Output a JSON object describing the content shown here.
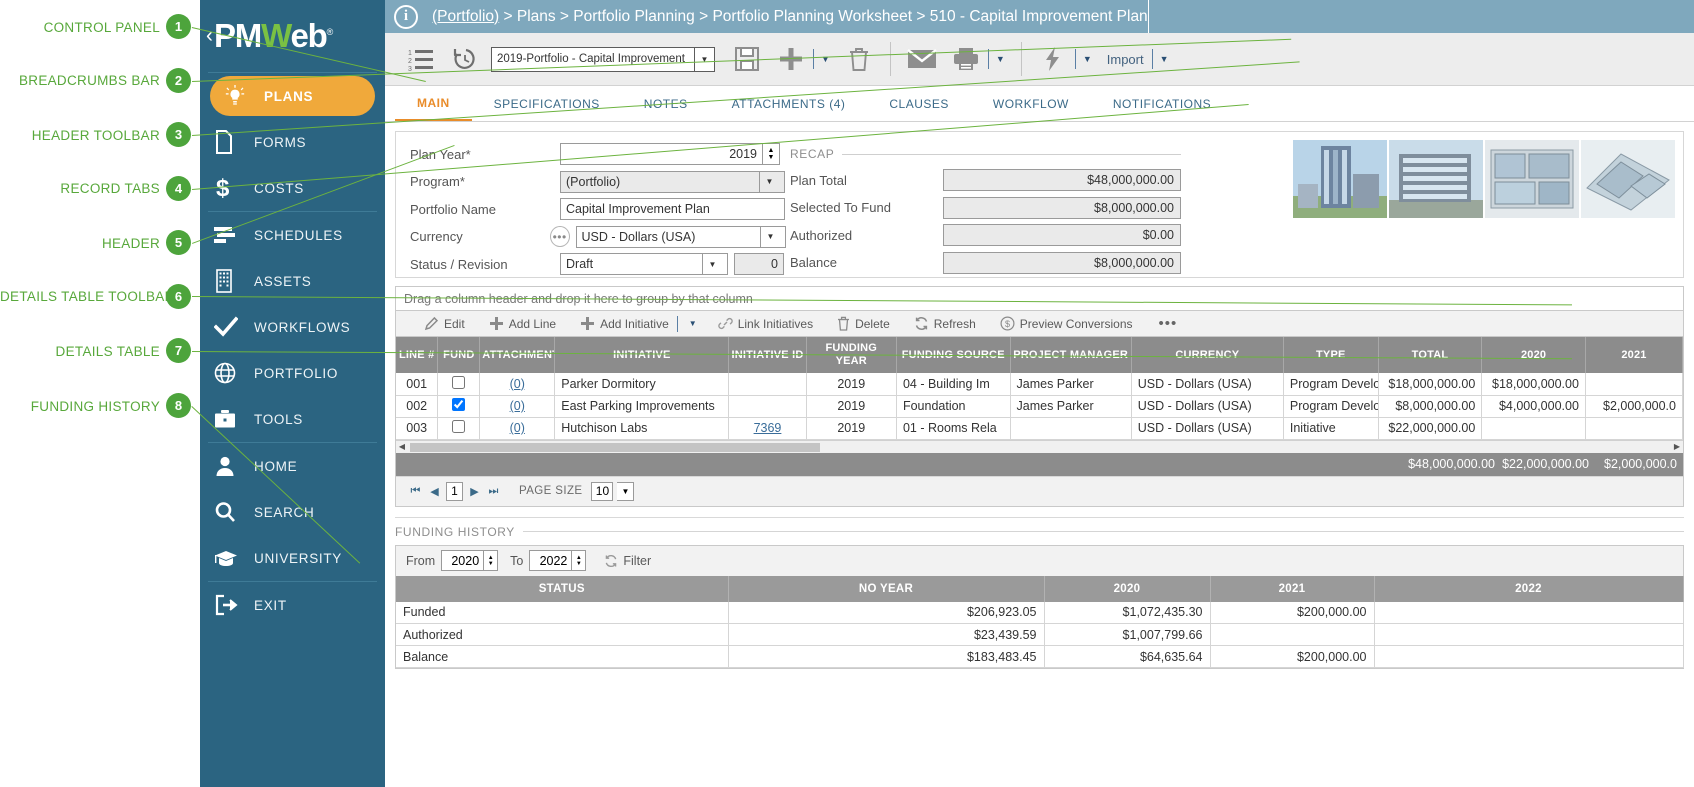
{
  "annotations": [
    {
      "n": "1",
      "label": "CONTROL PANEL"
    },
    {
      "n": "2",
      "label": "BREADCRUMBS BAR"
    },
    {
      "n": "3",
      "label": "HEADER TOOLBAR"
    },
    {
      "n": "4",
      "label": "RECORD TABS"
    },
    {
      "n": "5",
      "label": "HEADER"
    },
    {
      "n": "6",
      "label": "DETAILS TABLE TOOLBAR"
    },
    {
      "n": "7",
      "label": "DETAILS TABLE"
    },
    {
      "n": "8",
      "label": "FUNDING HISTORY"
    }
  ],
  "sidebar": {
    "logo": {
      "chevron": "‹",
      "pm": "PM",
      "w": "W",
      "eb": "eb",
      "reg": "®"
    },
    "items": [
      {
        "label": "PLANS",
        "icon": "lightbulb-icon",
        "active": true
      },
      {
        "label": "FORMS",
        "icon": "document-icon",
        "active": false
      },
      {
        "label": "COSTS",
        "icon": "dollar-icon",
        "active": false
      },
      {
        "label": "SCHEDULES",
        "icon": "schedule-icon",
        "active": false
      },
      {
        "label": "ASSETS",
        "icon": "building-icon",
        "active": false
      },
      {
        "label": "WORKFLOWS",
        "icon": "check-icon",
        "active": false
      },
      {
        "label": "PORTFOLIO",
        "icon": "globe-icon",
        "active": false
      },
      {
        "label": "TOOLS",
        "icon": "briefcase-icon",
        "active": false
      },
      {
        "label": "HOME",
        "icon": "person-icon",
        "active": false
      },
      {
        "label": "SEARCH",
        "icon": "search-icon",
        "active": false
      },
      {
        "label": "UNIVERSITY",
        "icon": "graduation-cap-icon",
        "active": false
      },
      {
        "label": "EXIT",
        "icon": "exit-icon",
        "active": false
      }
    ]
  },
  "breadcrumb": {
    "root": "(Portfolio)",
    "rest": " > Plans > Portfolio Planning > Portfolio Planning Worksheet > 510 - Capital Improvement Plan"
  },
  "toolbar": {
    "record_select_value": "2019-Portfolio - Capital Improvement",
    "import_label": "Import",
    "icons": [
      "list-icon",
      "history-icon",
      "save-icon",
      "add-icon",
      "delete-icon",
      "email-icon",
      "print-icon",
      "lightning-icon"
    ]
  },
  "tabs": [
    {
      "label": "MAIN",
      "active": true
    },
    {
      "label": "SPECIFICATIONS",
      "active": false
    },
    {
      "label": "NOTES",
      "active": false
    },
    {
      "label": "ATTACHMENTS (4)",
      "active": false
    },
    {
      "label": "CLAUSES",
      "active": false
    },
    {
      "label": "WORKFLOW",
      "active": false
    },
    {
      "label": "NOTIFICATIONS",
      "active": false
    }
  ],
  "header_form": {
    "plan_year": {
      "label": "Plan Year*",
      "value": "2019"
    },
    "program": {
      "label": "Program*",
      "value": "(Portfolio)"
    },
    "portfolio_name": {
      "label": "Portfolio Name",
      "value": "Capital Improvement Plan"
    },
    "currency": {
      "label": "Currency",
      "value": "USD - Dollars (USA)"
    },
    "status": {
      "label": "Status / Revision",
      "value": "Draft",
      "revision": "0"
    }
  },
  "recap": {
    "title": "RECAP",
    "rows": [
      {
        "label": "Plan Total",
        "value": "$48,000,000.00"
      },
      {
        "label": "Selected To Fund",
        "value": "$8,000,000.00"
      },
      {
        "label": "Authorized",
        "value": "$0.00"
      },
      {
        "label": "Balance",
        "value": "$8,000,000.00"
      }
    ]
  },
  "details": {
    "group_hint": "Drag a column header and drop it here to group by that column",
    "toolbar": [
      {
        "label": "Edit",
        "icon": "pencil-icon"
      },
      {
        "label": "Add Line",
        "icon": "plus-icon"
      },
      {
        "label": "Add Initiative",
        "icon": "plus-icon"
      },
      {
        "label": "Link Initiatives",
        "icon": "link-icon"
      },
      {
        "label": "Delete",
        "icon": "trash-icon"
      },
      {
        "label": "Refresh",
        "icon": "refresh-icon"
      },
      {
        "label": "Preview Conversions",
        "icon": "dollar-circle-icon"
      }
    ],
    "more_label": "•••",
    "columns": [
      "LINE #",
      "FUND",
      "ATTACHMENT",
      "INITIATIVE",
      "INITIATIVE ID",
      "FUNDING YEAR",
      "FUNDING SOURCE",
      "PROJECT MANAGER",
      "CURRENCY",
      "TYPE",
      "TOTAL",
      "2020",
      "2021"
    ],
    "rows": [
      {
        "line": "001",
        "fund": false,
        "attachment": "(0)",
        "initiative": "Parker Dormitory",
        "initiative_id": "",
        "funding_year": "2019",
        "funding_source": "04 - Building Im",
        "project_manager": "James Parker",
        "currency": "USD - Dollars (USA)",
        "type": "Program Develo",
        "total": "$18,000,000.00",
        "y2020": "$18,000,000.00",
        "y2021": ""
      },
      {
        "line": "002",
        "fund": true,
        "attachment": "(0)",
        "initiative": "East Parking Improvements",
        "initiative_id": "",
        "funding_year": "2019",
        "funding_source": "Foundation",
        "project_manager": "James Parker",
        "currency": "USD - Dollars (USA)",
        "type": "Program Develo",
        "total": "$8,000,000.00",
        "y2020": "$4,000,000.00",
        "y2021": "$2,000,000.0"
      },
      {
        "line": "003",
        "fund": false,
        "attachment": "(0)",
        "initiative": "Hutchison Labs",
        "initiative_id": "7369",
        "funding_year": "2019",
        "funding_source": "01 - Rooms Rela",
        "project_manager": "",
        "currency": "USD - Dollars (USA)",
        "type": "Initiative",
        "total": "$22,000,000.00",
        "y2020": "",
        "y2021": ""
      }
    ],
    "totals": {
      "total": "$48,000,000.00",
      "y2020": "$22,000,000.00",
      "y2021": "$2,000,000.0"
    },
    "pager": {
      "page": "1",
      "page_size_label": "PAGE SIZE",
      "page_size": "10",
      "first": "⏮",
      "prev": "◀",
      "next": "▶",
      "last": "⏭"
    }
  },
  "funding_history": {
    "title": "FUNDING HISTORY",
    "from_label": "From",
    "from_value": "2020",
    "to_label": "To",
    "to_value": "2022",
    "filter_label": "Filter",
    "columns": [
      "STATUS",
      "NO YEAR",
      "2020",
      "2021",
      "2022"
    ],
    "rows": [
      {
        "status": "Funded",
        "no_year": "$206,923.05",
        "y2020": "$1,072,435.30",
        "y2021": "$200,000.00",
        "y2022": ""
      },
      {
        "status": "Authorized",
        "no_year": "$23,439.59",
        "y2020": "$1,007,799.66",
        "y2021": "",
        "y2022": ""
      },
      {
        "status": "Balance",
        "no_year": "$183,483.45",
        "y2020": "$64,635.64",
        "y2021": "$200,000.00",
        "y2022": ""
      }
    ]
  },
  "colors": {
    "sidebar": "#2b6481",
    "accent_orange": "#f0a93b",
    "breadcrumb": "#7fa8bd",
    "annotation_green": "#6cb33f",
    "header_gray": "#8c8c8c"
  }
}
